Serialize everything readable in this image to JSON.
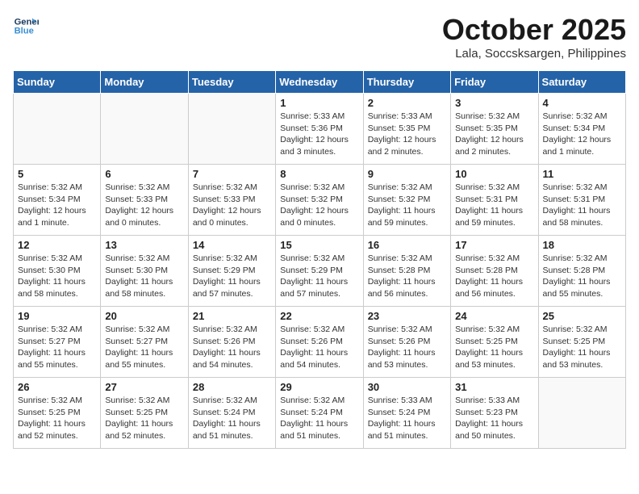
{
  "header": {
    "logo_line1": "General",
    "logo_line2": "Blue",
    "month": "October 2025",
    "location": "Lala, Soccsksargen, Philippines"
  },
  "days_of_week": [
    "Sunday",
    "Monday",
    "Tuesday",
    "Wednesday",
    "Thursday",
    "Friday",
    "Saturday"
  ],
  "weeks": [
    [
      {
        "day": "",
        "info": ""
      },
      {
        "day": "",
        "info": ""
      },
      {
        "day": "",
        "info": ""
      },
      {
        "day": "1",
        "info": "Sunrise: 5:33 AM\nSunset: 5:36 PM\nDaylight: 12 hours\nand 3 minutes."
      },
      {
        "day": "2",
        "info": "Sunrise: 5:33 AM\nSunset: 5:35 PM\nDaylight: 12 hours\nand 2 minutes."
      },
      {
        "day": "3",
        "info": "Sunrise: 5:32 AM\nSunset: 5:35 PM\nDaylight: 12 hours\nand 2 minutes."
      },
      {
        "day": "4",
        "info": "Sunrise: 5:32 AM\nSunset: 5:34 PM\nDaylight: 12 hours\nand 1 minute."
      }
    ],
    [
      {
        "day": "5",
        "info": "Sunrise: 5:32 AM\nSunset: 5:34 PM\nDaylight: 12 hours\nand 1 minute."
      },
      {
        "day": "6",
        "info": "Sunrise: 5:32 AM\nSunset: 5:33 PM\nDaylight: 12 hours\nand 0 minutes."
      },
      {
        "day": "7",
        "info": "Sunrise: 5:32 AM\nSunset: 5:33 PM\nDaylight: 12 hours\nand 0 minutes."
      },
      {
        "day": "8",
        "info": "Sunrise: 5:32 AM\nSunset: 5:32 PM\nDaylight: 12 hours\nand 0 minutes."
      },
      {
        "day": "9",
        "info": "Sunrise: 5:32 AM\nSunset: 5:32 PM\nDaylight: 11 hours\nand 59 minutes."
      },
      {
        "day": "10",
        "info": "Sunrise: 5:32 AM\nSunset: 5:31 PM\nDaylight: 11 hours\nand 59 minutes."
      },
      {
        "day": "11",
        "info": "Sunrise: 5:32 AM\nSunset: 5:31 PM\nDaylight: 11 hours\nand 58 minutes."
      }
    ],
    [
      {
        "day": "12",
        "info": "Sunrise: 5:32 AM\nSunset: 5:30 PM\nDaylight: 11 hours\nand 58 minutes."
      },
      {
        "day": "13",
        "info": "Sunrise: 5:32 AM\nSunset: 5:30 PM\nDaylight: 11 hours\nand 58 minutes."
      },
      {
        "day": "14",
        "info": "Sunrise: 5:32 AM\nSunset: 5:29 PM\nDaylight: 11 hours\nand 57 minutes."
      },
      {
        "day": "15",
        "info": "Sunrise: 5:32 AM\nSunset: 5:29 PM\nDaylight: 11 hours\nand 57 minutes."
      },
      {
        "day": "16",
        "info": "Sunrise: 5:32 AM\nSunset: 5:28 PM\nDaylight: 11 hours\nand 56 minutes."
      },
      {
        "day": "17",
        "info": "Sunrise: 5:32 AM\nSunset: 5:28 PM\nDaylight: 11 hours\nand 56 minutes."
      },
      {
        "day": "18",
        "info": "Sunrise: 5:32 AM\nSunset: 5:28 PM\nDaylight: 11 hours\nand 55 minutes."
      }
    ],
    [
      {
        "day": "19",
        "info": "Sunrise: 5:32 AM\nSunset: 5:27 PM\nDaylight: 11 hours\nand 55 minutes."
      },
      {
        "day": "20",
        "info": "Sunrise: 5:32 AM\nSunset: 5:27 PM\nDaylight: 11 hours\nand 55 minutes."
      },
      {
        "day": "21",
        "info": "Sunrise: 5:32 AM\nSunset: 5:26 PM\nDaylight: 11 hours\nand 54 minutes."
      },
      {
        "day": "22",
        "info": "Sunrise: 5:32 AM\nSunset: 5:26 PM\nDaylight: 11 hours\nand 54 minutes."
      },
      {
        "day": "23",
        "info": "Sunrise: 5:32 AM\nSunset: 5:26 PM\nDaylight: 11 hours\nand 53 minutes."
      },
      {
        "day": "24",
        "info": "Sunrise: 5:32 AM\nSunset: 5:25 PM\nDaylight: 11 hours\nand 53 minutes."
      },
      {
        "day": "25",
        "info": "Sunrise: 5:32 AM\nSunset: 5:25 PM\nDaylight: 11 hours\nand 53 minutes."
      }
    ],
    [
      {
        "day": "26",
        "info": "Sunrise: 5:32 AM\nSunset: 5:25 PM\nDaylight: 11 hours\nand 52 minutes."
      },
      {
        "day": "27",
        "info": "Sunrise: 5:32 AM\nSunset: 5:25 PM\nDaylight: 11 hours\nand 52 minutes."
      },
      {
        "day": "28",
        "info": "Sunrise: 5:32 AM\nSunset: 5:24 PM\nDaylight: 11 hours\nand 51 minutes."
      },
      {
        "day": "29",
        "info": "Sunrise: 5:32 AM\nSunset: 5:24 PM\nDaylight: 11 hours\nand 51 minutes."
      },
      {
        "day": "30",
        "info": "Sunrise: 5:33 AM\nSunset: 5:24 PM\nDaylight: 11 hours\nand 51 minutes."
      },
      {
        "day": "31",
        "info": "Sunrise: 5:33 AM\nSunset: 5:23 PM\nDaylight: 11 hours\nand 50 minutes."
      },
      {
        "day": "",
        "info": ""
      }
    ]
  ]
}
